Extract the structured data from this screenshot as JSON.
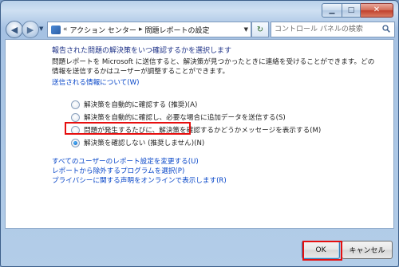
{
  "titlebar": {
    "minimize_icon": "minimize-icon",
    "maximize_icon": "maximize-icon",
    "close_icon": "close-icon"
  },
  "nav": {
    "back_icon": "back-arrow-icon",
    "forward_icon": "forward-arrow-icon",
    "address_prefix": "«",
    "breadcrumb": [
      "アクション センター",
      "問題レポートの設定"
    ],
    "search_placeholder": "コントロール パネルの検索"
  },
  "main": {
    "heading": "報告された問題の解決策をいつ確認するかを選択します",
    "description": "問題レポートを Microsoft に送信すると、解決策が見つかったときに連絡を受けることができます。どの情報を送信するかはユーザーが調整することができます。",
    "info_link": "送信される情報について(W)",
    "radio_options": [
      {
        "label": "解決策を自動的に確認する (推奨)(A)",
        "checked": false
      },
      {
        "label": "解決策を自動的に確認し、必要な場合に追加データを送信する(S)",
        "checked": false
      },
      {
        "label": "問題が発生するたびに、解決策を確認するかどうかメッセージを表示する(M)",
        "checked": false
      },
      {
        "label": "解決策を確認しない (推奨しません)(N)",
        "checked": true
      }
    ],
    "links": [
      "すべてのユーザーのレポート設定を変更する(U)",
      "レポートから除外するプログラムを選択(P)",
      "プライバシーに関する声明をオンラインで表示します(R)"
    ]
  },
  "footer": {
    "ok_label": "OK",
    "cancel_label": "キャンセル"
  },
  "colors": {
    "highlight": "#e60f0f",
    "link": "#0645c8",
    "heading": "#1e3287"
  }
}
